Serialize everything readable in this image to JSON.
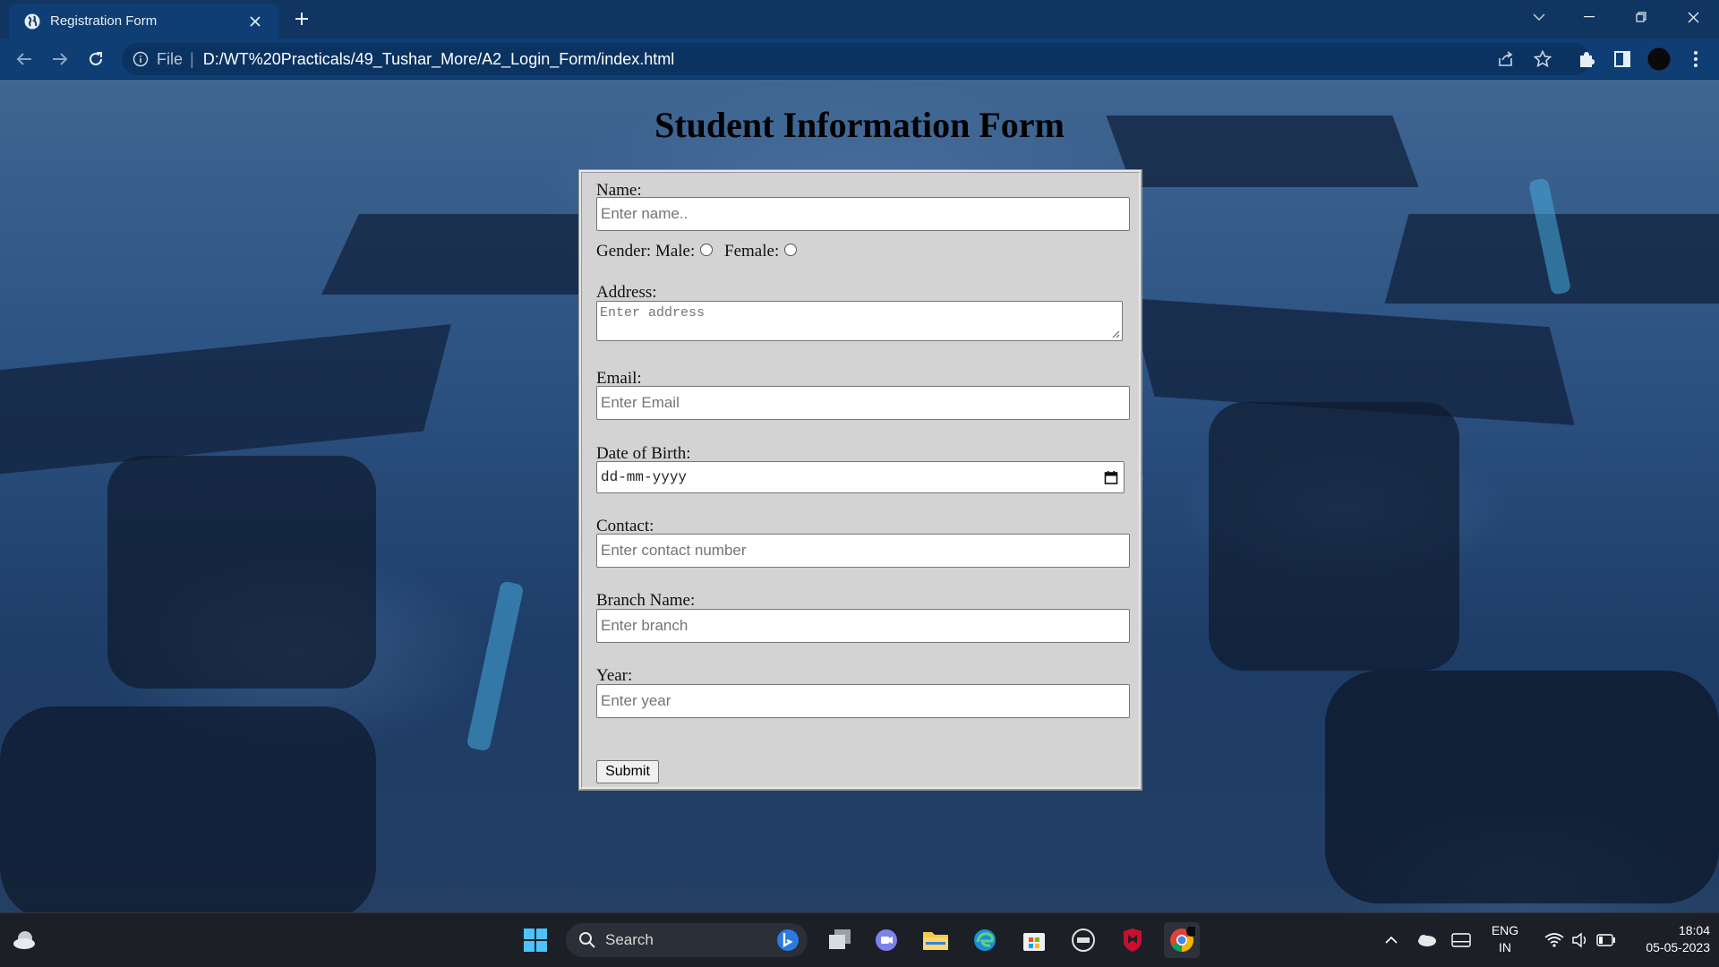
{
  "browser": {
    "tab_title": "Registration Form",
    "url_scheme": "File",
    "url": "D:/WT%20Practicals/49_Tushar_More/A2_Login_Form/index.html"
  },
  "page": {
    "title": "Student Information Form",
    "form": {
      "name_label": "Name:",
      "name_placeholder": "Enter name..",
      "gender_label": "Gender:",
      "male_label": "Male:",
      "female_label": "Female:",
      "address_label": "Address:",
      "address_placeholder": "Enter address",
      "email_label": "Email:",
      "email_placeholder": "Enter Email",
      "dob_label": "Date of Birth:",
      "dob_placeholder": "dd-mm-yyyy",
      "contact_label": "Contact:",
      "contact_placeholder": "Enter contact number",
      "branch_label": "Branch Name:",
      "branch_placeholder": "Enter branch",
      "year_label": "Year:",
      "year_placeholder": "Enter year",
      "submit_label": "Submit"
    }
  },
  "taskbar": {
    "search_label": "Search",
    "language": "ENG",
    "region": "IN",
    "time": "18:04",
    "date": "05-05-2023"
  },
  "colors": {
    "tab_bar": "#113561",
    "toolbar": "#0f3e74",
    "form_background": "#d3d3d3",
    "taskbar": "#1c1f26"
  }
}
